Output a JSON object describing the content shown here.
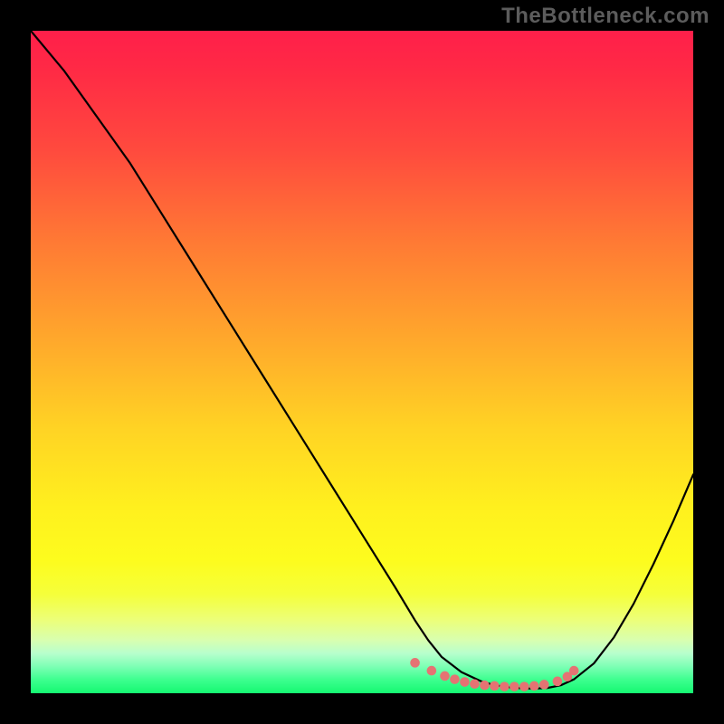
{
  "watermark": "TheBottleneck.com",
  "chart_data": {
    "type": "line",
    "title": "",
    "xlabel": "",
    "ylabel": "",
    "xlim": [
      0,
      100
    ],
    "ylim": [
      0,
      100
    ],
    "grid": false,
    "legend": false,
    "series": [
      {
        "name": "bottleneck-curve",
        "color": "#000000",
        "x": [
          0,
          5,
          10,
          15,
          20,
          25,
          30,
          35,
          40,
          45,
          50,
          55,
          58,
          60,
          62,
          65,
          68,
          70,
          73,
          76,
          78,
          80,
          82,
          85,
          88,
          91,
          94,
          97,
          100
        ],
        "y": [
          100,
          94,
          87,
          80,
          72,
          64,
          56,
          48,
          40,
          32,
          24,
          16,
          11,
          8,
          5.5,
          3.2,
          1.8,
          1.2,
          0.8,
          0.7,
          0.8,
          1.2,
          2.1,
          4.5,
          8.4,
          13.5,
          19.5,
          26,
          33
        ]
      }
    ],
    "markers": {
      "name": "optimal-range-dots",
      "color": "#e57373",
      "x": [
        58,
        60.5,
        62.5,
        64,
        65.5,
        67,
        68.5,
        70,
        71.5,
        73,
        74.5,
        76,
        77.5,
        79.5,
        81,
        82
      ],
      "y": [
        4.6,
        3.4,
        2.6,
        2.1,
        1.7,
        1.4,
        1.2,
        1.1,
        1.0,
        1.0,
        1.0,
        1.1,
        1.3,
        1.8,
        2.5,
        3.4
      ]
    },
    "background_gradient": {
      "stops": [
        {
          "pos": 0.0,
          "color": "#ff1f4a"
        },
        {
          "pos": 0.18,
          "color": "#ff4a3e"
        },
        {
          "pos": 0.46,
          "color": "#ffa62c"
        },
        {
          "pos": 0.72,
          "color": "#fff01e"
        },
        {
          "pos": 0.92,
          "color": "#d8ffb0"
        },
        {
          "pos": 1.0,
          "color": "#15f871"
        }
      ]
    }
  }
}
